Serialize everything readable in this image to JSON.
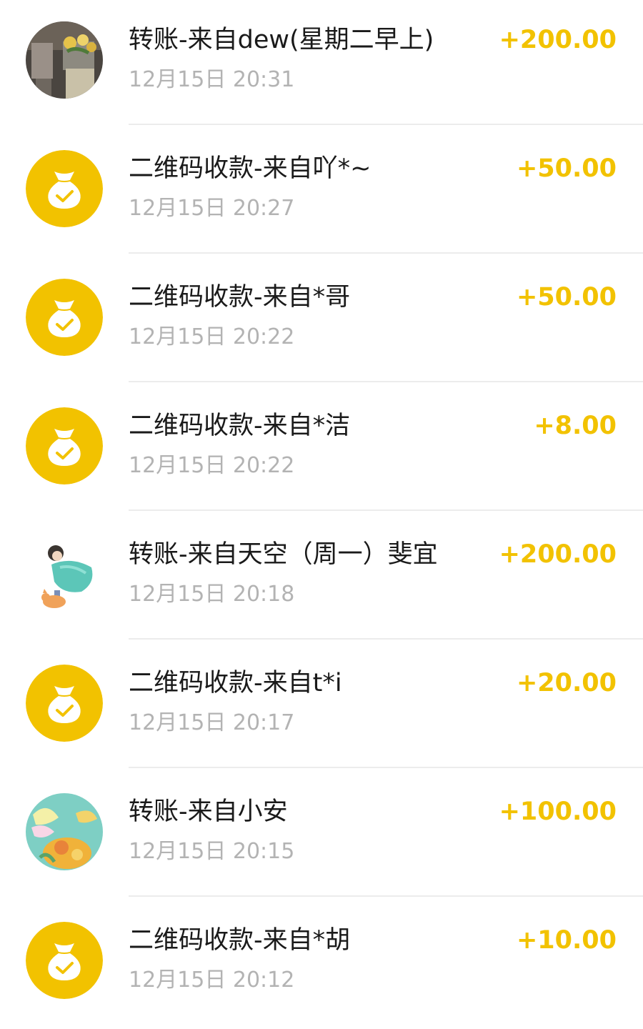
{
  "colors": {
    "amount": "#f2c200",
    "qr_icon_bg": "#f2c200",
    "time": "#b3b3b3",
    "divider": "#ececec"
  },
  "transactions": [
    {
      "title": "转账-来自dew(星期二早上)",
      "time": "12月15日 20:31",
      "amount": "+200.00",
      "icon": "avatar-photo-plants"
    },
    {
      "title": "二维码收款-来自吖*~",
      "time": "12月15日 20:27",
      "amount": "+50.00",
      "icon": "money-bag-check-icon"
    },
    {
      "title": "二维码收款-来自*哥",
      "time": "12月15日 20:22",
      "amount": "+50.00",
      "icon": "money-bag-check-icon"
    },
    {
      "title": "二维码收款-来自*洁",
      "time": "12月15日 20:22",
      "amount": "+8.00",
      "icon": "money-bag-check-icon"
    },
    {
      "title": "转账-来自天空（周一）斐宜",
      "time": "12月15日 20:18",
      "amount": "+200.00",
      "icon": "avatar-illustration-girl-cat"
    },
    {
      "title": "二维码收款-来自t*i",
      "time": "12月15日 20:17",
      "amount": "+20.00",
      "icon": "money-bag-check-icon"
    },
    {
      "title": "转账-来自小安",
      "time": "12月15日 20:15",
      "amount": "+100.00",
      "icon": "avatar-illustration-butterfly"
    },
    {
      "title": "二维码收款-来自*胡",
      "time": "12月15日 20:12",
      "amount": "+10.00",
      "icon": "money-bag-check-icon"
    }
  ]
}
